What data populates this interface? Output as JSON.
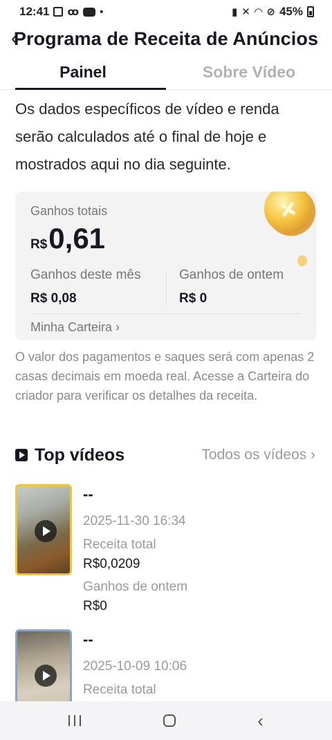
{
  "status_bar": {
    "time": "12:41",
    "battery": "45%"
  },
  "header": {
    "title": "Programa de Receita de Anúncios"
  },
  "tabs": [
    {
      "label": "Painel",
      "active": true
    },
    {
      "label": "Sobre Vídeo",
      "active": false
    }
  ],
  "intro": "Os dados específicos de vídeo e renda serão calculados até o final de hoje e mostrados aqui no dia seguinte.",
  "earnings": {
    "total_label": "Ganhos totais",
    "currency": "R$",
    "total_value": "0,61",
    "month_label": "Ganhos deste mês",
    "month_value": "R$ 0,08",
    "yesterday_label": "Ganhos de ontem",
    "yesterday_value": "R$ 0",
    "wallet_link": "Minha Carteira ›"
  },
  "note": "O valor dos pagamentos e saques será com apenas 2 casas decimais em moeda real. Acesse a Carteira do criador para verificar os detalhes da receita.",
  "top_videos": {
    "title": "Top vídeos",
    "all_link": "Todos os vídeos ›",
    "items": [
      {
        "title": "--",
        "date": "2025-11-30 16:34",
        "revenue_label": "Receita total",
        "revenue_value": "R$0,0209",
        "yesterday_label": "Ganhos de ontem",
        "yesterday_value": "R$0"
      },
      {
        "title": "--",
        "date": "2025-10-09 10:06",
        "revenue_label": "Receita total"
      }
    ]
  },
  "colors": {
    "accent_text": "#161823",
    "card_bg": "#f3f3f4",
    "muted": "#9a9aa0"
  }
}
